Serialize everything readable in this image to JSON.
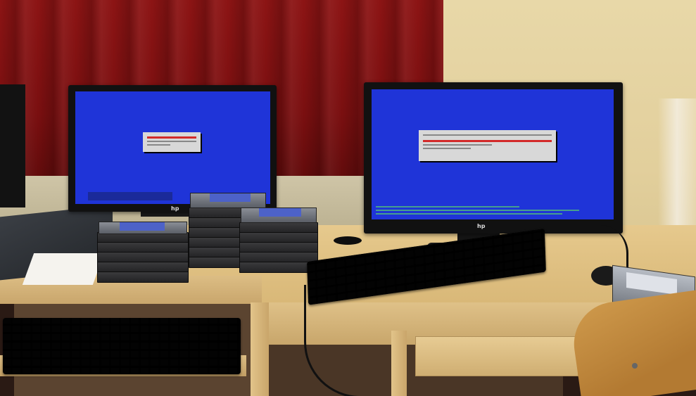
{
  "scene": {
    "description_tags": [
      "two-monitors",
      "hard-drive-stacks",
      "keyboards",
      "desk"
    ],
    "colors": {
      "screen_blue": "#1f34d8",
      "dialog_gray": "#d8d8d8",
      "dialog_red": "#d32a2a",
      "console_green": "#5fe65f",
      "curtain_red": "#8c1414",
      "desk_wood": "#e6c98d"
    }
  },
  "monitors": {
    "left": {
      "brand": "hp"
    },
    "right": {
      "brand": "hp"
    }
  }
}
